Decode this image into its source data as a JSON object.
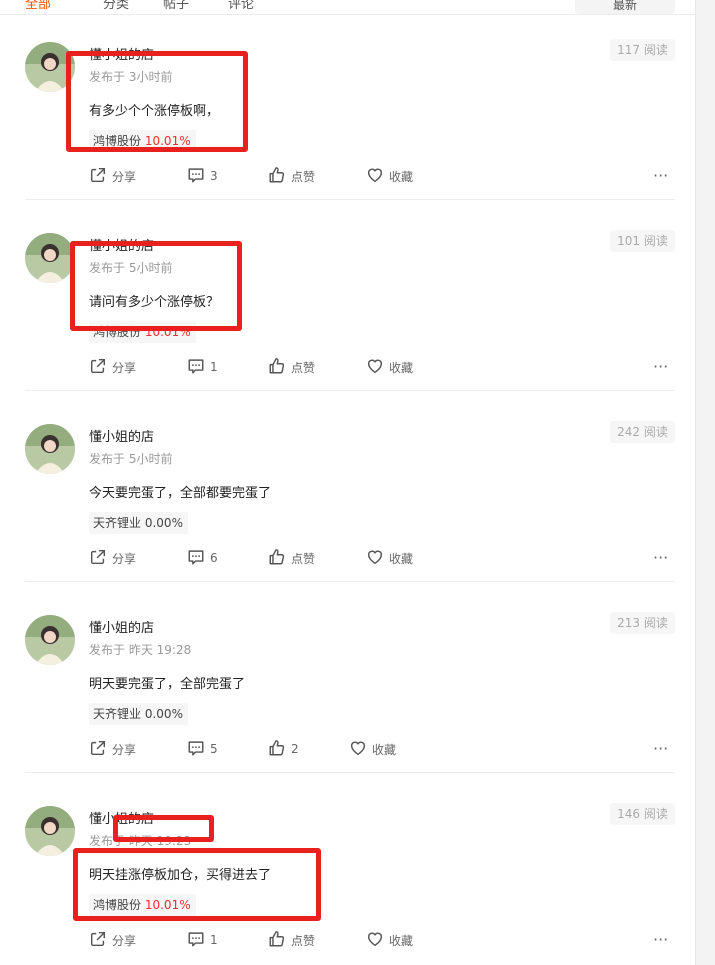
{
  "topbar": {
    "tabs": [
      {
        "label": "全部"
      },
      {
        "label": "分类"
      },
      {
        "label": "帖子"
      },
      {
        "label": "评论"
      }
    ],
    "top_button": "最新"
  },
  "colors": {
    "highlight": "#e8211f",
    "up": "#e93030",
    "accent": "#ff5500"
  },
  "actions": {
    "share": "分享",
    "like": "点赞",
    "collect": "收藏",
    "more": "···"
  },
  "posts": [
    {
      "author": "懂小姐的店",
      "time": "发布于 3小时前",
      "reads": "117 阅读",
      "content": "有多少个个涨停板啊，",
      "stock": {
        "name": "鸿博股份",
        "pct": "10.01%"
      },
      "comments": "3",
      "likes": "点赞",
      "collect": "收藏"
    },
    {
      "author": "懂小姐的店",
      "time": "发布于 5小时前",
      "reads": "101 阅读",
      "content": "请问有多少个涨停板？",
      "stock": {
        "name": "鸿博股份",
        "pct": "10.01%"
      },
      "comments": "1",
      "likes": "点赞",
      "collect": "收藏"
    },
    {
      "author": "懂小姐的店",
      "time": "发布于 5小时前",
      "reads": "242 阅读",
      "content": "今天要完蛋了，全部都要完蛋了",
      "stock": {
        "name": "天齐锂业",
        "pct": "0.00%"
      },
      "comments": "6",
      "likes": "点赞",
      "collect": "收藏"
    },
    {
      "author": "懂小姐的店",
      "time": "发布于 昨天 19:28",
      "reads": "213 阅读",
      "content": "明天要完蛋了，全部完蛋了",
      "stock": {
        "name": "天齐锂业",
        "pct": "0.00%"
      },
      "comments": "5",
      "likes": "2",
      "collect": "收藏"
    },
    {
      "author": "懂小姐的店",
      "time": "发布于 昨天 19:23",
      "reads": "146 阅读",
      "content": "明天挂涨停板加仓，买得进去了",
      "stock": {
        "name": "鸿博股份",
        "pct": "10.01%"
      },
      "comments": "1",
      "likes": "点赞",
      "collect": "收藏"
    }
  ]
}
